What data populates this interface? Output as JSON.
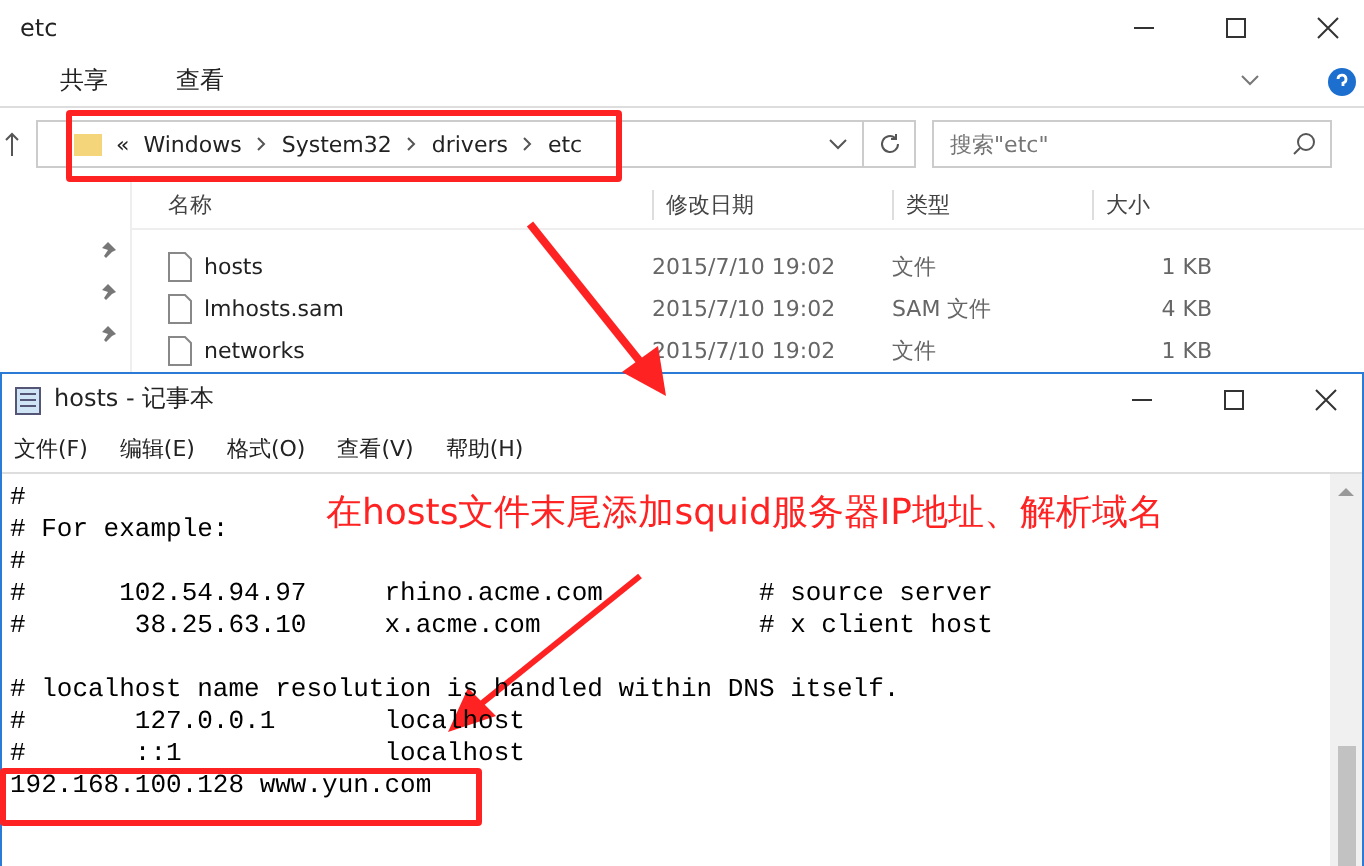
{
  "explorer": {
    "title": "etc",
    "ribbon_tabs": [
      "共享",
      "查看"
    ],
    "breadcrumb_overflow": "«",
    "path": [
      "Windows",
      "System32",
      "drivers",
      "etc"
    ],
    "search": {
      "placeholder": "搜索\"etc\""
    },
    "columns": [
      "名称",
      "修改日期",
      "类型",
      "大小"
    ],
    "files": [
      {
        "name": "hosts",
        "date": "2015/7/10 19:02",
        "type": "文件",
        "size": "1 KB"
      },
      {
        "name": "lmhosts.sam",
        "date": "2015/7/10 19:02",
        "type": "SAM 文件",
        "size": "4 KB"
      },
      {
        "name": "networks",
        "date": "2015/7/10 19:02",
        "type": "文件",
        "size": "1 KB"
      }
    ]
  },
  "notepad": {
    "title": "hosts - 记事本",
    "menu": [
      "文件(F)",
      "编辑(E)",
      "格式(O)",
      "查看(V)",
      "帮助(H)"
    ],
    "blocks": [
      [
        "#",
        "# For example:",
        "#",
        "#      102.54.94.97     rhino.acme.com          # source server",
        "#       38.25.63.10     x.acme.com              # x client host"
      ],
      [
        "# localhost name resolution is handled within DNS itself.",
        "#       127.0.0.1       localhost",
        "#       ::1             localhost",
        "192.168.100.128 www.yun.com"
      ]
    ]
  },
  "annotation": "在hosts文件末尾添加squid服务器IP地址、解析域名"
}
